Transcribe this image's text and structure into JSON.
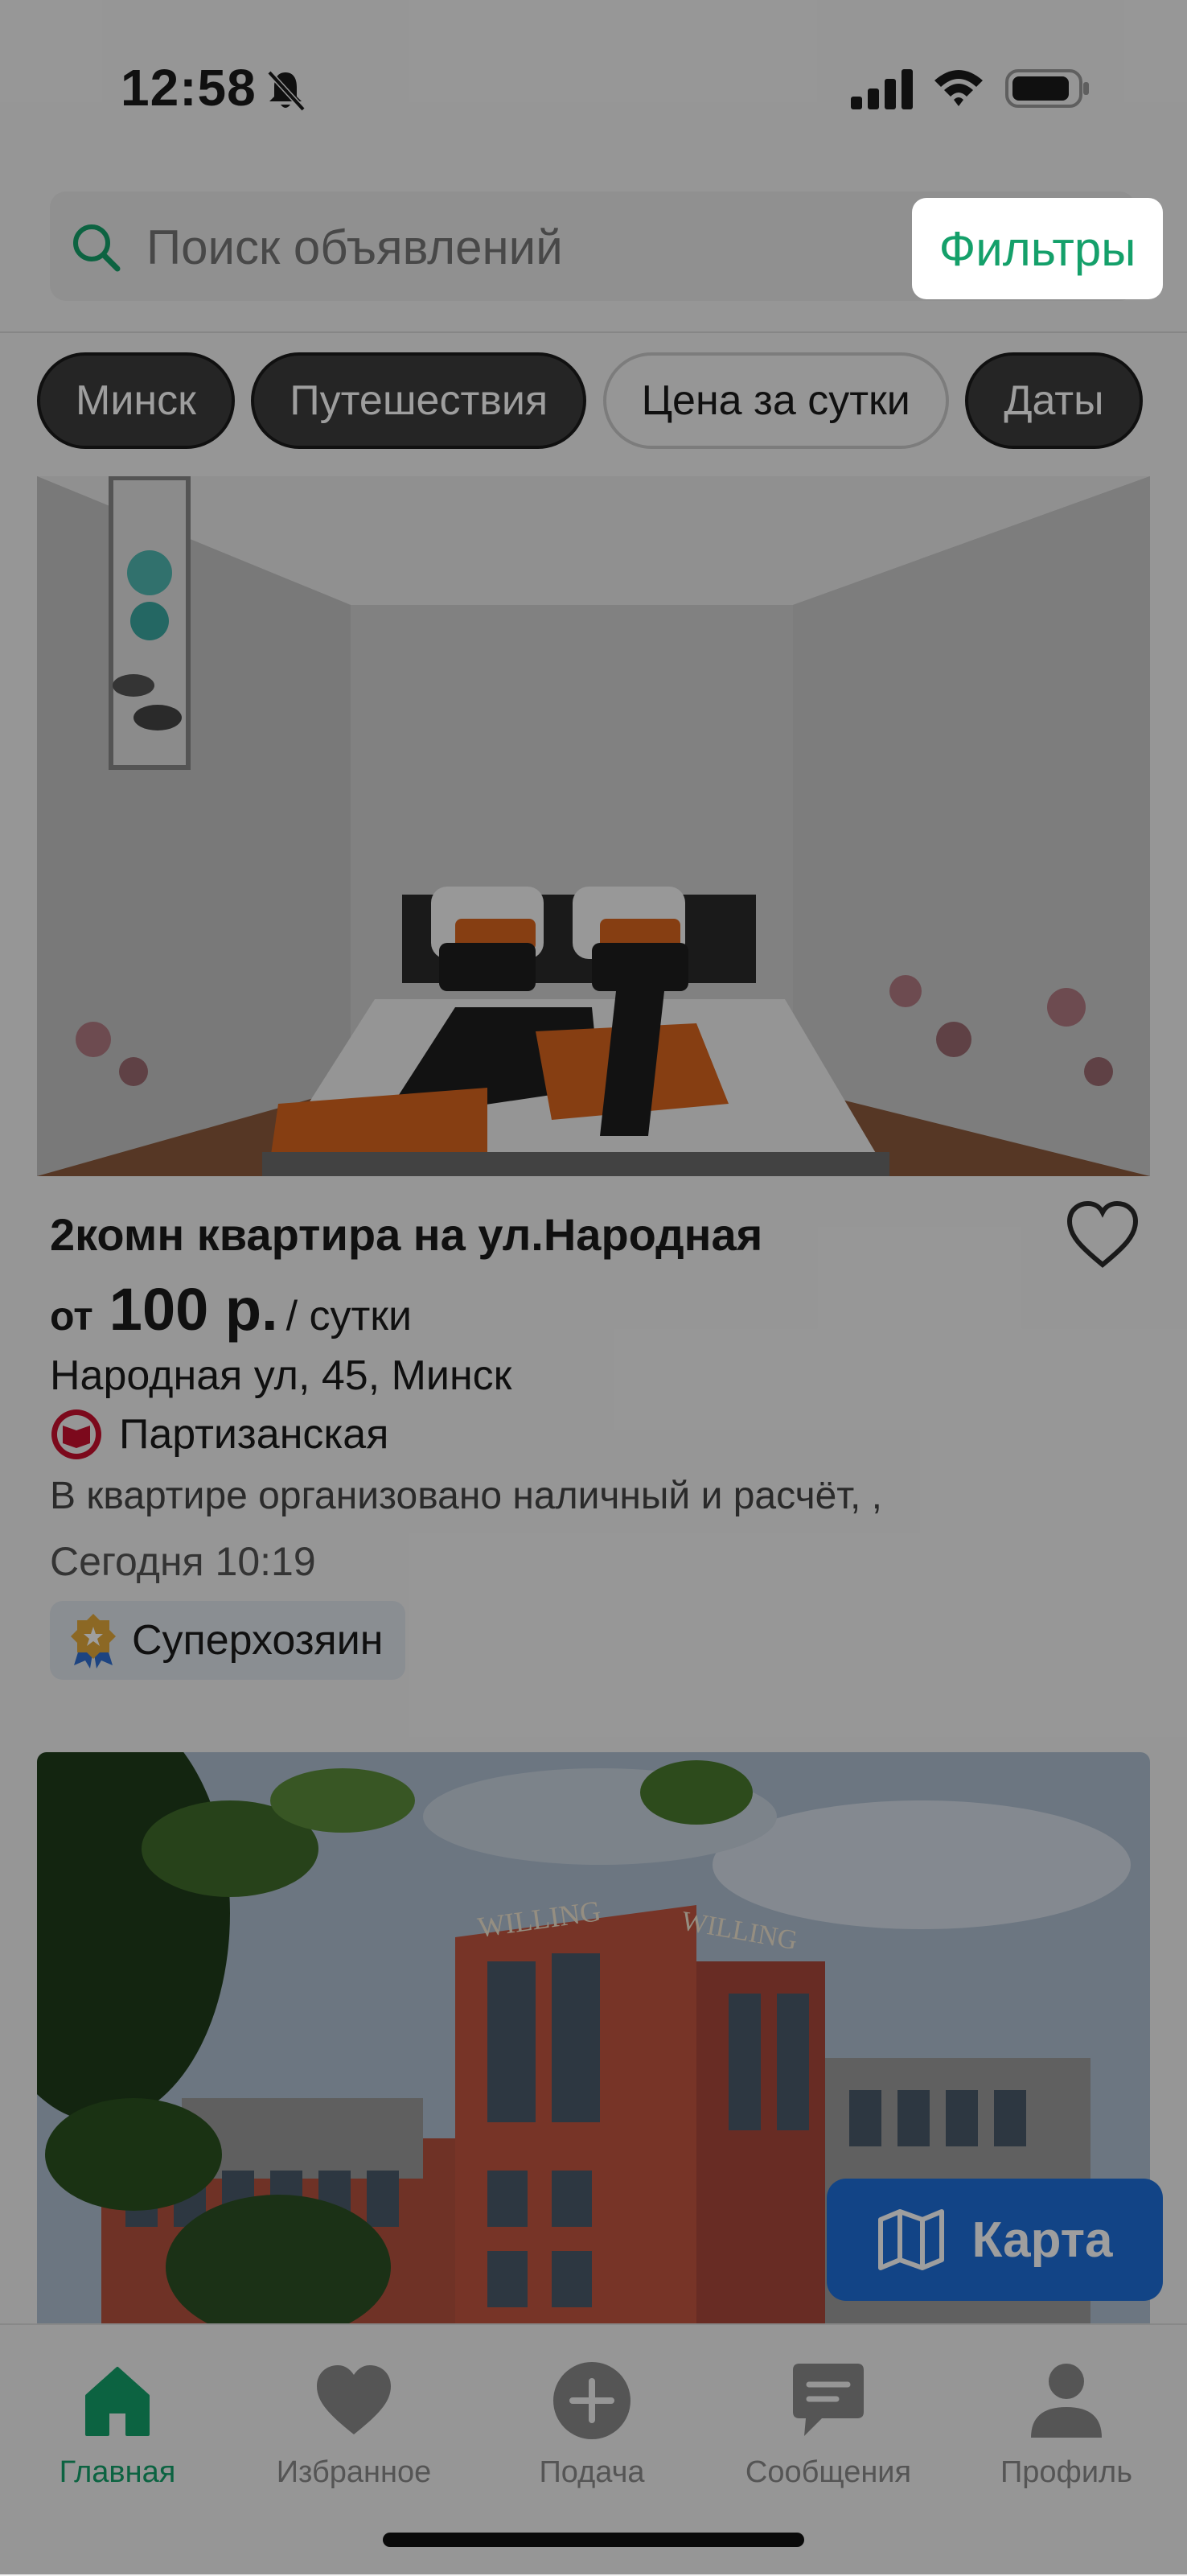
{
  "status": {
    "time": "12:58"
  },
  "search": {
    "placeholder": "Поиск объявлений",
    "filters_label": "Фильтры"
  },
  "chips": [
    "Минск",
    "Путешествия",
    "Цена за сутки",
    "Даты"
  ],
  "listing": {
    "title": "2комн квартира на ул.Народная",
    "price_from": "от",
    "price": "100 р.",
    "price_unit": "/ сутки",
    "address": "Народная ул, 45, Минск",
    "metro": "Партизанская",
    "description": " В квартире организовано наличный и расчёт, ,",
    "date": "Сегодня 10:19",
    "badge": "Суперхозяин",
    "photo_count_dots": 5,
    "active_photo": 1
  },
  "map_button": {
    "label": "Карта"
  },
  "tabbar": {
    "items": [
      {
        "label": "Главная",
        "icon": "home-icon",
        "active": true
      },
      {
        "label": "Избранное",
        "icon": "heart-icon",
        "active": false
      },
      {
        "label": "Подача",
        "icon": "plus-circle-icon",
        "active": false
      },
      {
        "label": "Сообщения",
        "icon": "message-icon",
        "active": false
      },
      {
        "label": "Профиль",
        "icon": "profile-icon",
        "active": false
      }
    ]
  },
  "colors": {
    "accent": "#14a06a",
    "map_button": "#1e6fd9",
    "metro_red": "#c8102e"
  }
}
